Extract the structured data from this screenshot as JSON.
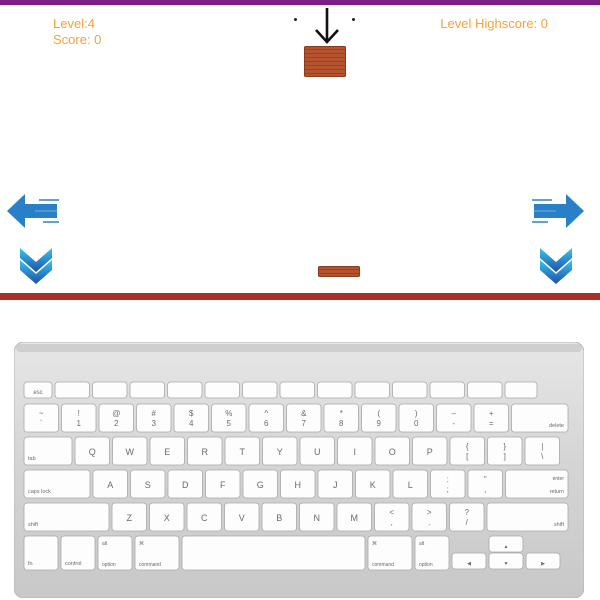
{
  "colors": {
    "accent": "#f2a23a",
    "top_bar": "#7b1f86",
    "floor": "#a9302a",
    "brick": "#b5532f",
    "arrow": "#2a80c7"
  },
  "hud": {
    "level_label": "Level:4",
    "score_label": "Score: 0",
    "highscore_label": "Level Highscore: 0"
  },
  "icons": {
    "drop": "down-arrow-icon",
    "left": "left-arrow-icon",
    "right": "right-arrow-icon",
    "down": "chevron-down-icon"
  },
  "keyboard": {
    "row_fn": [
      "esc",
      "",
      "",
      "",
      "",
      "",
      "",
      "",
      "",
      "",
      "",
      "",
      ""
    ],
    "row_num": [
      {
        "top": "~",
        "bottom": "`"
      },
      {
        "top": "!",
        "bottom": "1"
      },
      {
        "top": "@",
        "bottom": "2"
      },
      {
        "top": "#",
        "bottom": "3"
      },
      {
        "top": "$",
        "bottom": "4"
      },
      {
        "top": "%",
        "bottom": "5"
      },
      {
        "top": "^",
        "bottom": "6"
      },
      {
        "top": "&",
        "bottom": "7"
      },
      {
        "top": "*",
        "bottom": "8"
      },
      {
        "top": "(",
        "bottom": "9"
      },
      {
        "top": ")",
        "bottom": "0"
      },
      {
        "top": "–",
        "bottom": "-"
      },
      {
        "top": "+",
        "bottom": "="
      }
    ],
    "delete": "delete",
    "tab": "tab",
    "row_q": [
      "Q",
      "W",
      "E",
      "R",
      "T",
      "Y",
      "U",
      "I",
      "O",
      "P"
    ],
    "row_q_sym": [
      {
        "top": "{",
        "bottom": "["
      },
      {
        "top": "}",
        "bottom": "]"
      },
      {
        "top": "|",
        "bottom": "\\"
      }
    ],
    "caps": "caps lock",
    "row_a": [
      "A",
      "S",
      "D",
      "F",
      "G",
      "H",
      "J",
      "K",
      "L"
    ],
    "row_a_sym": [
      {
        "top": ":",
        "bottom": ";"
      },
      {
        "top": "\"",
        "bottom": ","
      }
    ],
    "enter_top": "enter",
    "enter_bottom": "return",
    "shift": "shift",
    "row_z": [
      "Z",
      "X",
      "C",
      "V",
      "B",
      "N",
      "M"
    ],
    "row_z_sym": [
      {
        "top": "<",
        "bottom": ","
      },
      {
        "top": ">",
        "bottom": "."
      },
      {
        "top": "?",
        "bottom": "/"
      }
    ],
    "fn": "fn",
    "control": "control",
    "option": "option",
    "alt": "alt",
    "cmd_symbol": "⌘",
    "command": "command",
    "arrow_up": "▲",
    "arrow_left": "◀",
    "arrow_down": "▼",
    "arrow_right": "▶"
  }
}
